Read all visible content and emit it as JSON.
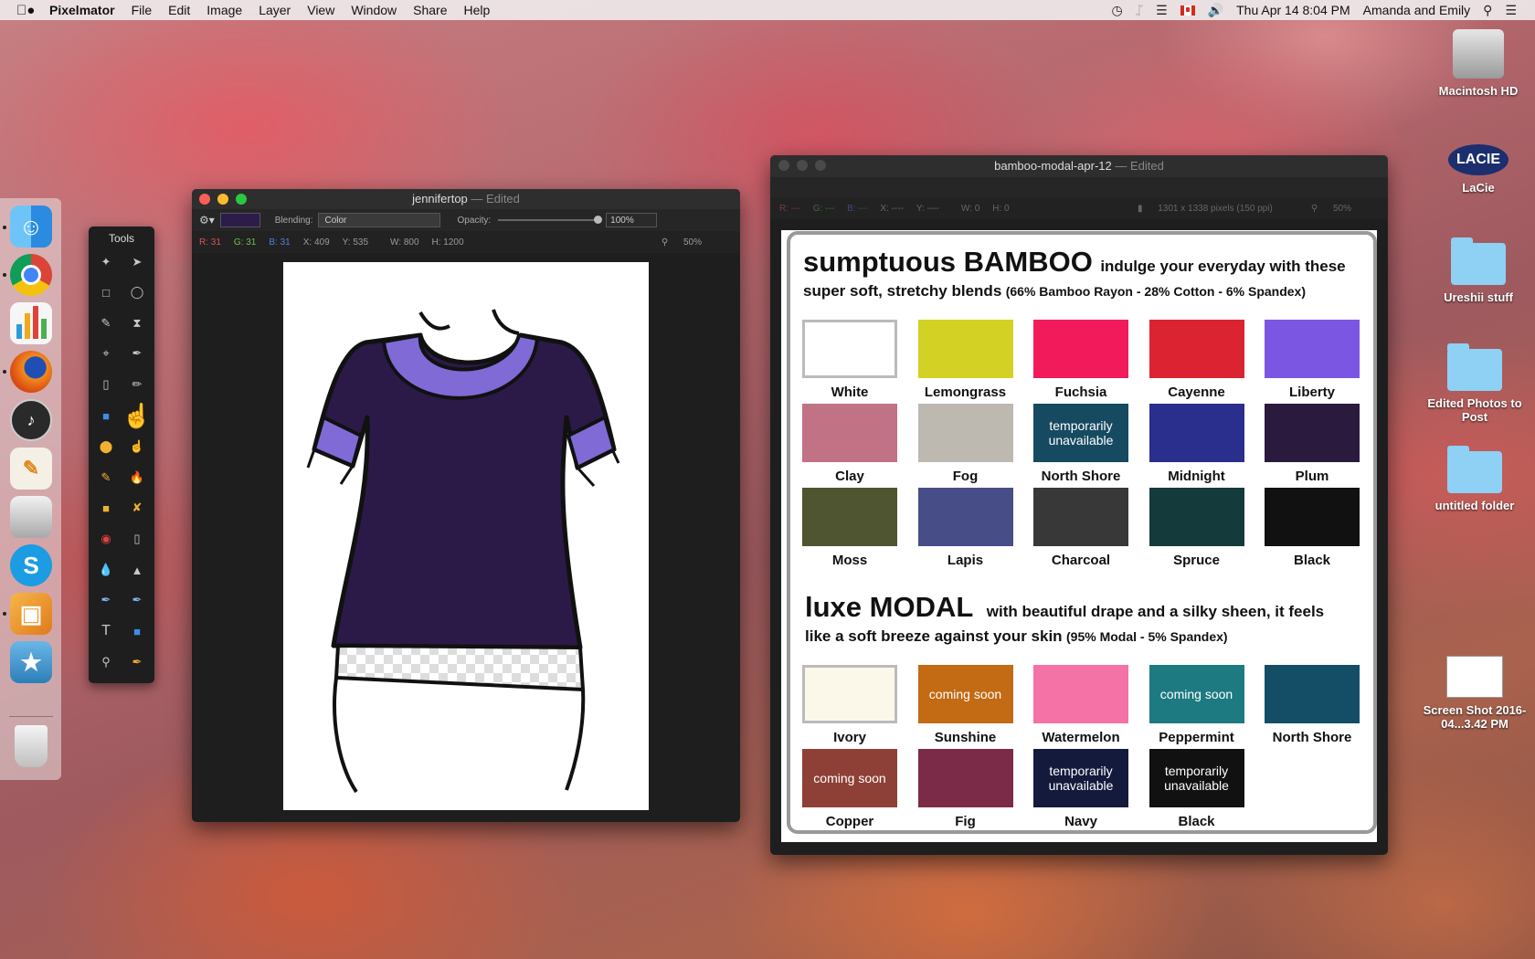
{
  "menubar": {
    "app_name": "Pixelmator",
    "items": [
      "File",
      "Edit",
      "Image",
      "Layer",
      "View",
      "Window",
      "Share",
      "Help"
    ],
    "clock": "Thu Apr 14  8:04 PM",
    "user": "Amanda and Emily"
  },
  "desktop_icons": [
    {
      "label": "Macintosh HD"
    },
    {
      "label": "LaCie"
    },
    {
      "label": "Ureshii stuff"
    },
    {
      "label": "Edited Photos to Post"
    },
    {
      "label": "untitled folder"
    },
    {
      "label": "Screen Shot 2016-04...3.42 PM"
    }
  ],
  "lacie_logo": "LACIE",
  "tools": {
    "title": "Tools"
  },
  "window1": {
    "title": "jennifertop",
    "edited": "— Edited",
    "blending_label": "Blending:",
    "blending_value": "Color",
    "opacity_label": "Opacity:",
    "opacity_value": "100%",
    "info": {
      "r": "R: 31",
      "g": "G: 31",
      "b": "B: 31",
      "x": "X: 409",
      "y": "Y: 535",
      "w": "W: 800",
      "h": "H: 1200",
      "zoom": "50%"
    },
    "fill_color": "#2b1a47",
    "trim_color": "#7f6ad6"
  },
  "window2": {
    "title": "bamboo-modal-apr-12",
    "edited": "— Edited",
    "info": {
      "r": "R: ---",
      "g": "G: ---",
      "b": "B: ---",
      "x": "X: ----",
      "y": "Y: ----",
      "w": "W: 0",
      "h": "H: 0",
      "size": "1301 x 1338 pixels (150 ppi)",
      "zoom": "50%"
    },
    "bamboo": {
      "title_big": "sumptuous BAMBOO",
      "title_rest": "indulge your everyday with these",
      "line2": "super soft, stretchy blends",
      "line2_paren": "(66% Bamboo Rayon - 28% Cotton - 6% Spandex)"
    },
    "modal": {
      "title_big": "luxe MODAL",
      "title_rest": "with beautiful drape and a silky sheen, it feels",
      "line2": "like a soft breeze against your skin",
      "line2_paren": "(95% Modal - 5% Spandex)"
    },
    "bamboo_fabrics": [
      {
        "name": "White",
        "color": "#ffffff",
        "note": ""
      },
      {
        "name": "Lemongrass",
        "color": "#d3d123",
        "note": ""
      },
      {
        "name": "Fuchsia",
        "color": "#f21a5a",
        "note": ""
      },
      {
        "name": "Cayenne",
        "color": "#db2331",
        "note": ""
      },
      {
        "name": "Liberty",
        "color": "#7b56e3",
        "note": ""
      },
      {
        "name": "Clay",
        "color": "#c27285",
        "note": ""
      },
      {
        "name": "Fog",
        "color": "#bdb8b0",
        "note": ""
      },
      {
        "name": "North Shore",
        "color": "#164a60",
        "note": "temporarily unavailable"
      },
      {
        "name": "Midnight",
        "color": "#2a2e8d",
        "note": ""
      },
      {
        "name": "Plum",
        "color": "#2a1a3d",
        "note": ""
      },
      {
        "name": "Moss",
        "color": "#4f5530",
        "note": ""
      },
      {
        "name": "Lapis",
        "color": "#474d86",
        "note": ""
      },
      {
        "name": "Charcoal",
        "color": "#383838",
        "note": ""
      },
      {
        "name": "Spruce",
        "color": "#143a3c",
        "note": ""
      },
      {
        "name": "Black",
        "color": "#111111",
        "note": ""
      }
    ],
    "modal_fabrics": [
      {
        "name": "Ivory",
        "color": "#fbf8ea",
        "note": ""
      },
      {
        "name": "Sunshine",
        "color": "#c26a14",
        "note": "coming soon"
      },
      {
        "name": "Watermelon",
        "color": "#f472a5",
        "note": ""
      },
      {
        "name": "Peppermint",
        "color": "#1c7a80",
        "note": "coming soon"
      },
      {
        "name": "North Shore",
        "color": "#134e66",
        "note": ""
      },
      {
        "name": "Copper",
        "color": "#8e4036",
        "note": "coming soon"
      },
      {
        "name": "Fig",
        "color": "#7b2a48",
        "note": ""
      },
      {
        "name": "Navy",
        "color": "#141a3c",
        "note": "temporarily unavailable"
      },
      {
        "name": "Black",
        "color": "#111111",
        "note": "temporarily unavailable"
      }
    ]
  }
}
